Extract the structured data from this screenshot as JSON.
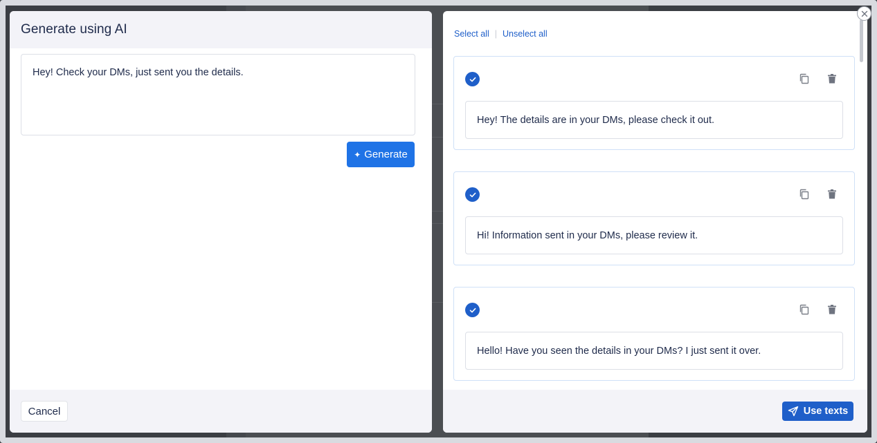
{
  "left_panel": {
    "title": "Generate using AI",
    "prompt_text": "Hey! Check your DMs, just sent you the details.",
    "generate_label": "Generate",
    "cancel_label": "Cancel"
  },
  "right_panel": {
    "select_all_label": "Select all",
    "unselect_all_label": "Unselect all",
    "results": [
      {
        "text": "Hey! The details are in your DMs, please check it out.",
        "selected": true
      },
      {
        "text": "Hi! Information sent in your DMs, please review it.",
        "selected": true
      },
      {
        "text": "Hello! Have you seen the details in your DMs? I just sent it over.",
        "selected": true
      }
    ],
    "use_texts_label": "Use texts"
  },
  "icons": {
    "check": "check-circle-icon",
    "copy": "copy-icon",
    "trash": "trash-icon",
    "send": "send-icon",
    "sparkle": "sparkle-icon",
    "close": "close-icon"
  },
  "colors": {
    "primary": "#1f73e6",
    "accent": "#1f5fc9",
    "panel_bg": "#f3f3f8",
    "card_border": "#cfe0f7"
  }
}
